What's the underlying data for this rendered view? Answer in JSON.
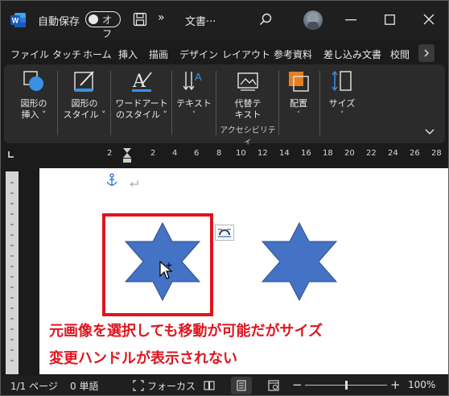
{
  "titlebar": {
    "autosave_label": "自動保存",
    "autosave_state": "オフ",
    "more": "»",
    "doc_title": "文書···"
  },
  "tabs": [
    "ファイル",
    "タッチ",
    "ホーム",
    "挿入",
    "描画",
    "デザイン",
    "レイアウト",
    "参考資料",
    "差し込み文書",
    "校閲"
  ],
  "ribbon": {
    "shape_insert": [
      "図形の",
      "挿入 ˅"
    ],
    "shape_style": [
      "図形の",
      "スタイル ˅"
    ],
    "wordart_style": [
      "ワードアート",
      "のスタイル ˅"
    ],
    "text": [
      "テキスト",
      "˅"
    ],
    "alt_text": [
      "代替テ",
      "キスト"
    ],
    "accessibility": "アクセシビリティ",
    "arrange": [
      "配置",
      "˅"
    ],
    "size": [
      "サイズ",
      "˅"
    ]
  },
  "ruler_numbers": [
    "2",
    "2",
    "4",
    "6",
    "8",
    "10",
    "12",
    "14",
    "16",
    "18",
    "20",
    "22",
    "24",
    "26",
    "28"
  ],
  "document": {
    "annotation_line1": "元画像を選択しても移動が可能だがサイズ",
    "annotation_line2": "変更ハンドルが表示されない"
  },
  "status": {
    "page": "1/1 ページ",
    "words": "0 単語",
    "focus": "フォーカス",
    "zoom": "100%",
    "minus": "−",
    "plus": "+"
  },
  "colors": {
    "shape_fill": "#4472c4",
    "annotation_red": "#e0141e",
    "word_blue": "#185abd",
    "arrange_orange": "#e67e22"
  }
}
